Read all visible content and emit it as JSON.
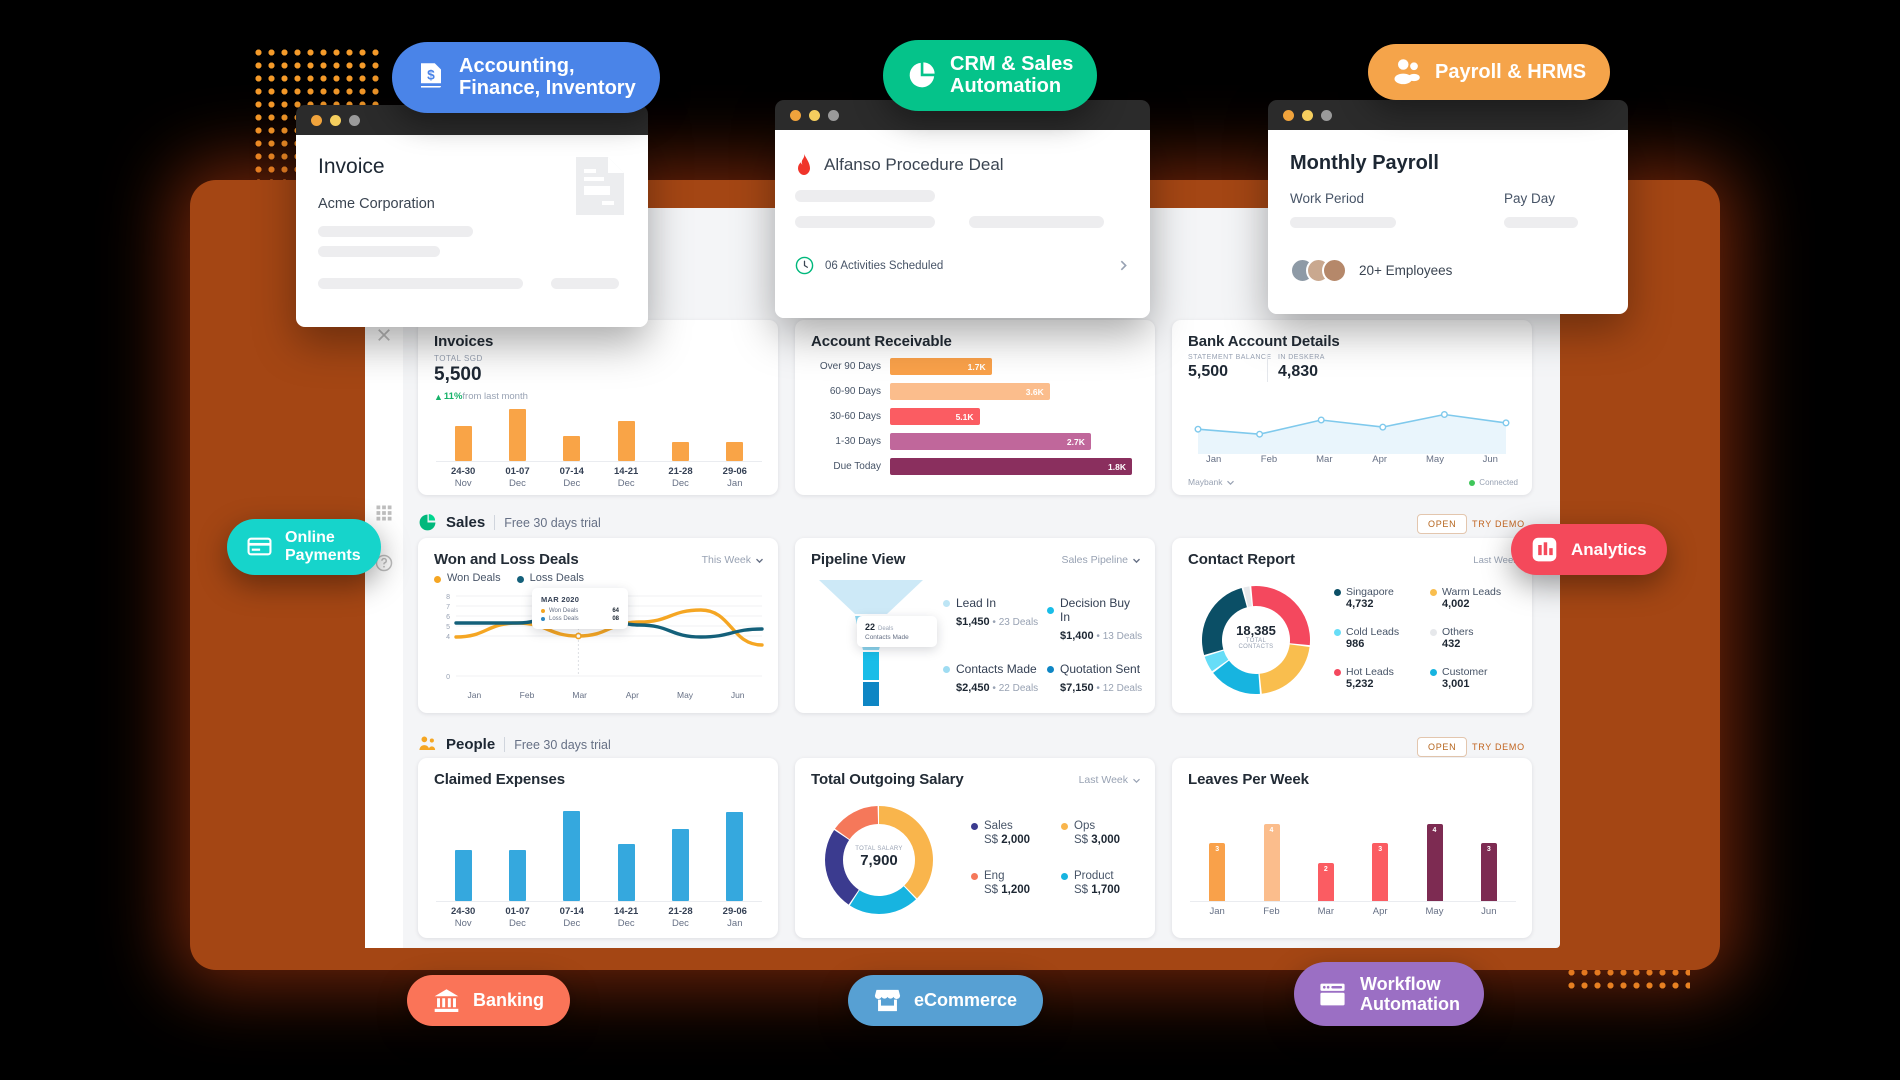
{
  "badges": {
    "accounting": {
      "label": "Accounting,\nFinance, Inventory",
      "color": "#4A84E8",
      "icon": "invoice-dollar-icon"
    },
    "crm": {
      "label": "CRM & Sales\nAutomation",
      "color": "#05C38A",
      "icon": "pie-chart-icon"
    },
    "payroll": {
      "label": "Payroll & HRMS",
      "color": "#F5A44A",
      "icon": "people-icon"
    },
    "payments": {
      "label": "Online\nPayments",
      "color": "#16D4CB",
      "icon": "credit-card-icon"
    },
    "analytics": {
      "label": "Analytics",
      "color": "#F4495B",
      "icon": "bar-chart-icon"
    },
    "banking": {
      "label": "Banking",
      "color": "#FA7458",
      "icon": "bank-icon"
    },
    "ecommerce": {
      "label": "eCommerce",
      "color": "#57A0D3",
      "icon": "storefront-icon"
    },
    "workflow": {
      "label": "Workflow\nAutomation",
      "color": "#9B6FC4",
      "icon": "browser-window-icon"
    }
  },
  "invoice_window": {
    "title": "Invoice",
    "customer": "Acme Corporation",
    "doc_icon": "document-icon"
  },
  "deal_window": {
    "title": "Alfanso Procedure Deal",
    "flame_icon": "flame-icon",
    "clock_icon": "clock-icon",
    "activities": "06 Activities Scheduled",
    "arrow_icon": "chevron-right-icon"
  },
  "payroll_window": {
    "title": "Monthly Payroll",
    "work_period_label": "Work Period",
    "pay_day_label": "Pay Day",
    "employees": "20+ Employees",
    "avatar_icon": "avatar"
  },
  "invoices_card": {
    "title": "Invoices",
    "total_label": "TOTAL SGD",
    "total_value": "5,500",
    "trend_arrow": "▲",
    "trend_pct": "11%",
    "trend_text": " from last month",
    "bar_color": "#F9A447"
  },
  "account_receivable": {
    "title": "Account Receivable"
  },
  "bank_card": {
    "title": "Bank Account Details",
    "statement_label": "STATEMENT BALANCE",
    "statement_value": "5,500",
    "deskera_label": "IN DESKERA",
    "deskera_value": "4,830",
    "bank_name": "Maybank",
    "status": "Connected",
    "status_color": "#3FC65A",
    "line_color": "#7FC9EC"
  },
  "sales_section": {
    "icon": "pie-chart-icon",
    "name": "Sales",
    "trial": "Free 30 days trial",
    "open": "OPEN",
    "try_demo": "TRY DEMO"
  },
  "people_section": {
    "icon": "people-icon",
    "name": "People",
    "trial": "Free 30 days trial",
    "open": "OPEN",
    "try_demo": "TRY DEMO"
  },
  "won_loss": {
    "title": "Won and Loss Deals",
    "period": "This Week",
    "legend": [
      {
        "label": "Won Deals",
        "color": "#F5A623"
      },
      {
        "label": "Loss Deals",
        "color": "#14607A"
      }
    ],
    "tooltip": {
      "heading": "MAR 2020",
      "rows": [
        {
          "label": "Won Deals",
          "value": "64",
          "color": "#F5A623"
        },
        {
          "label": "Loss Deals",
          "value": "08",
          "color": "#2E86C1"
        }
      ]
    }
  },
  "pipeline": {
    "title": "Pipeline View",
    "period": "Sales Pipeline",
    "tooltip_count": "22",
    "tooltip_deals": "Deals",
    "tooltip_stage": "Contacts Made",
    "stages": [
      {
        "name": "Lead In",
        "amount": "$1,450",
        "deals": "23 Deals",
        "color": "#BDE5F5"
      },
      {
        "name": "Decision Buy In",
        "amount": "$1,400",
        "deals": "13 Deals",
        "color": "#19BDE8"
      },
      {
        "name": "Contacts Made",
        "amount": "$2,450",
        "deals": "22 Deals",
        "color": "#9FDCF2"
      },
      {
        "name": "Quotation Sent",
        "amount": "$7,150",
        "deals": "12 Deals",
        "color": "#0E86C4"
      }
    ]
  },
  "contact_report": {
    "title": "Contact Report",
    "period": "Last Week",
    "center_value": "18,385",
    "center_label": "TOTAL CONTACTS",
    "legend": [
      {
        "label": "Singapore",
        "value": "4,732",
        "color": "#0B4F66"
      },
      {
        "label": "Warm Leads",
        "value": "4,002",
        "color": "#F9BE4E"
      },
      {
        "label": "Cold Leads",
        "value": "986",
        "color": "#67DDF7"
      },
      {
        "label": "Others",
        "value": "432",
        "color": "#E6E8EB"
      },
      {
        "label": "Hot Leads",
        "value": "5,232",
        "color": "#F4485E"
      },
      {
        "label": "Customer",
        "value": "3,001",
        "color": "#17B4E0"
      }
    ]
  },
  "claimed_expenses": {
    "title": "Claimed Expenses",
    "bar_color": "#35A8DE"
  },
  "outgoing_salary": {
    "title": "Total Outgoing Salary",
    "period": "Last Week",
    "center_label": "TOTAL SALARY",
    "center_value": "7,900",
    "legend": [
      {
        "label": "Sales",
        "value": "S$ 2,000",
        "color": "#3B3B8F"
      },
      {
        "label": "Ops",
        "value": "S$ 3,000",
        "color": "#F9B54C"
      },
      {
        "label": "Eng",
        "value": "S$ 1,200",
        "color": "#F5785A"
      },
      {
        "label": "Product",
        "value": "S$ 1,700",
        "color": "#17B4E0"
      }
    ]
  },
  "leaves": {
    "title": "Leaves Per Week"
  },
  "chart_data": [
    {
      "type": "bar",
      "title": "Invoices",
      "categories": [
        "24-30\nNov",
        "01-07\nDec",
        "07-14\nDec",
        "14-21\nDec",
        "21-28\nDec",
        "29-06\nJan"
      ],
      "values": [
        62,
        92,
        44,
        72,
        34,
        34
      ],
      "ylim": [
        0,
        100
      ],
      "color": "#F9A447",
      "xlabel": "",
      "ylabel": "",
      "grid": false
    },
    {
      "type": "bar",
      "orientation": "horizontal",
      "title": "Account Receivable",
      "categories": [
        "Over 90 Days",
        "60-90 Days",
        "30-60 Days",
        "1-30 Days",
        "Due Today"
      ],
      "values": [
        1.7,
        3.6,
        5.1,
        2.7,
        1.8
      ],
      "value_labels": [
        "1.7K",
        "3.6K",
        "5.1K",
        "2.7K",
        "1.8K"
      ],
      "bar_widths_pct": [
        42,
        66,
        37,
        83,
        100
      ],
      "colors": [
        "#F9A14A",
        "#FBBD8C",
        "#FB5C62",
        "#C0679B",
        "#8A2F5E"
      ],
      "xlabel": "",
      "ylabel": "",
      "grid": false
    },
    {
      "type": "area",
      "title": "Bank Account Details",
      "x": [
        "Jan",
        "Feb",
        "Mar",
        "Apr",
        "May",
        "Jun"
      ],
      "series": [
        {
          "name": "Balance",
          "values": [
            40,
            28,
            62,
            45,
            75,
            55
          ]
        }
      ],
      "ylim": [
        0,
        100
      ],
      "color": "#7FC9EC",
      "grid": false
    },
    {
      "type": "line",
      "title": "Won and Loss Deals",
      "x": [
        "Jan",
        "Feb",
        "Mar",
        "Apr",
        "May",
        "Jun"
      ],
      "yticks": [
        0,
        4,
        5,
        6,
        7,
        8
      ],
      "ylim": [
        0,
        8
      ],
      "series": [
        {
          "name": "Won Deals",
          "values": [
            3.9,
            5.3,
            4.0,
            5.4,
            6.6,
            3.1
          ],
          "color": "#F5A623"
        },
        {
          "name": "Loss Deals",
          "values": [
            5.3,
            5.3,
            6.7,
            5.1,
            3.9,
            4.7
          ],
          "color": "#14607A"
        }
      ],
      "legend_position": "top-left",
      "grid": true
    },
    {
      "type": "pie",
      "title": "Contact Report",
      "labels": [
        "Hot Leads",
        "Warm Leads",
        "Customer",
        "Cold Leads",
        "Singapore",
        "Others"
      ],
      "values": [
        5232,
        4002,
        3001,
        986,
        4732,
        432
      ],
      "colors": [
        "#F4485E",
        "#F9BE4E",
        "#17B4E0",
        "#67DDF7",
        "#0B4F66",
        "#E6E8EB"
      ],
      "total": 18385,
      "donut": true
    },
    {
      "type": "bar",
      "title": "Claimed Expenses",
      "categories": [
        "24-30\nNov",
        "01-07\nDec",
        "07-14\nDec",
        "14-21\nDec",
        "21-28\nDec",
        "29-06\nJan"
      ],
      "values": [
        52,
        52,
        92,
        58,
        73,
        91
      ],
      "ylim": [
        0,
        100
      ],
      "color": "#35A8DE",
      "grid": false
    },
    {
      "type": "pie",
      "title": "Total Outgoing Salary",
      "labels": [
        "Ops",
        "Product",
        "Sales",
        "Eng"
      ],
      "values": [
        3000,
        1700,
        2000,
        1200
      ],
      "colors": [
        "#F9B54C",
        "#17B4E0",
        "#3B3B8F",
        "#F5785A"
      ],
      "total": 7900,
      "donut": true
    },
    {
      "type": "bar",
      "title": "Leaves Per Week",
      "categories": [
        "Jan",
        "Feb",
        "Mar",
        "Apr",
        "May",
        "Jun"
      ],
      "values": [
        3,
        4,
        2,
        3,
        4,
        3
      ],
      "colors": [
        "#F9A14A",
        "#FBBD8C",
        "#FB5C62",
        "#FB5C62",
        "#7D2B52",
        "#7D2B52"
      ],
      "ylim": [
        0,
        5
      ],
      "grid": false
    }
  ]
}
